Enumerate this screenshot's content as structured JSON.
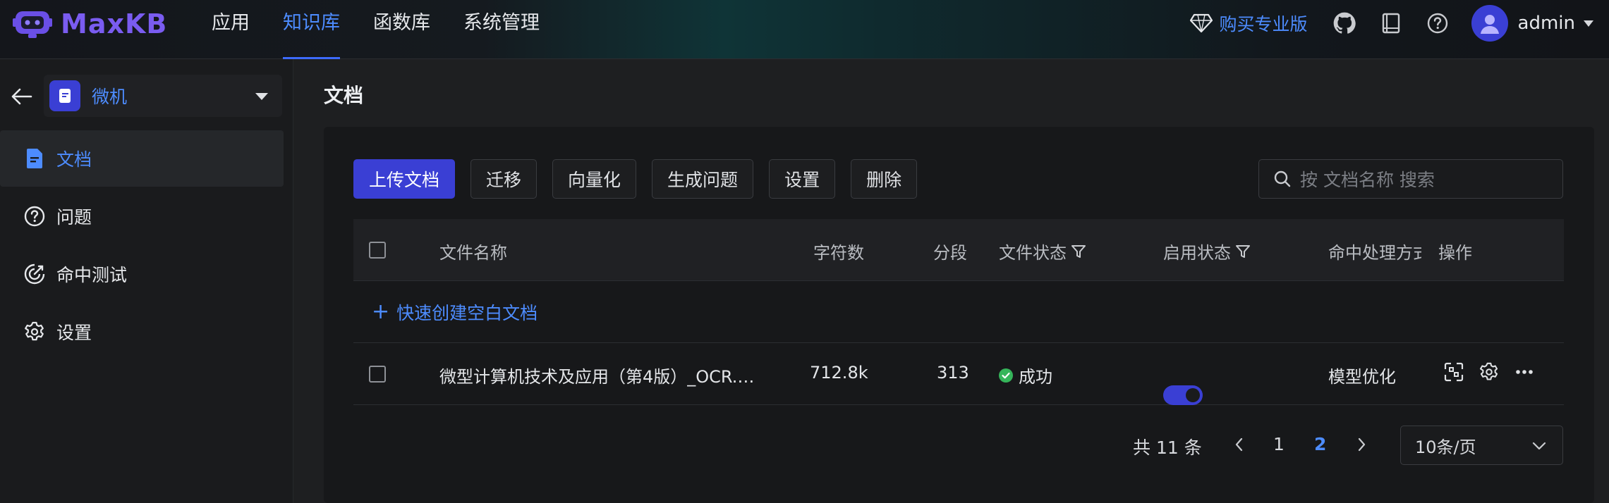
{
  "app": {
    "name": "MaxKB"
  },
  "topnav": {
    "items": [
      {
        "label": "应用",
        "active": false
      },
      {
        "label": "知识库",
        "active": true
      },
      {
        "label": "函数库",
        "active": false
      },
      {
        "label": "系统管理",
        "active": false
      }
    ],
    "pro_label": "购买专业版",
    "user_name": "admin"
  },
  "sidebar": {
    "kb_name": "微机",
    "items": [
      {
        "label": "文档",
        "icon": "document-icon",
        "active": true
      },
      {
        "label": "问题",
        "icon": "question-icon",
        "active": false
      },
      {
        "label": "命中测试",
        "icon": "target-icon",
        "active": false
      },
      {
        "label": "设置",
        "icon": "gear-icon",
        "active": false
      }
    ]
  },
  "page": {
    "title": "文档"
  },
  "toolbar": {
    "upload": "上传文档",
    "migrate": "迁移",
    "vectorize": "向量化",
    "generate": "生成问题",
    "settings": "设置",
    "delete": "删除"
  },
  "search": {
    "placeholder": "按 文档名称 搜索"
  },
  "table": {
    "columns": {
      "name": "文件名称",
      "chars": "字符数",
      "segments": "分段",
      "file_status": "文件状态",
      "enabled": "启用状态",
      "hit_handling": "命中处理方式",
      "actions": "操作"
    },
    "quick_create": "快速创建空白文档",
    "rows": [
      {
        "name": "微型计算机技术及应用（第4版）_OCR.…",
        "chars": "712.8k",
        "segments": "313",
        "file_status": "成功",
        "enabled": true,
        "hit_handling": "模型优化"
      }
    ]
  },
  "pagination": {
    "total": "共 11 条",
    "pages": [
      "1",
      "2"
    ],
    "current": "2",
    "page_size": "10条/页"
  },
  "colors": {
    "accent": "#3a3fd4",
    "link": "#4d8cff",
    "success": "#35b55a"
  }
}
